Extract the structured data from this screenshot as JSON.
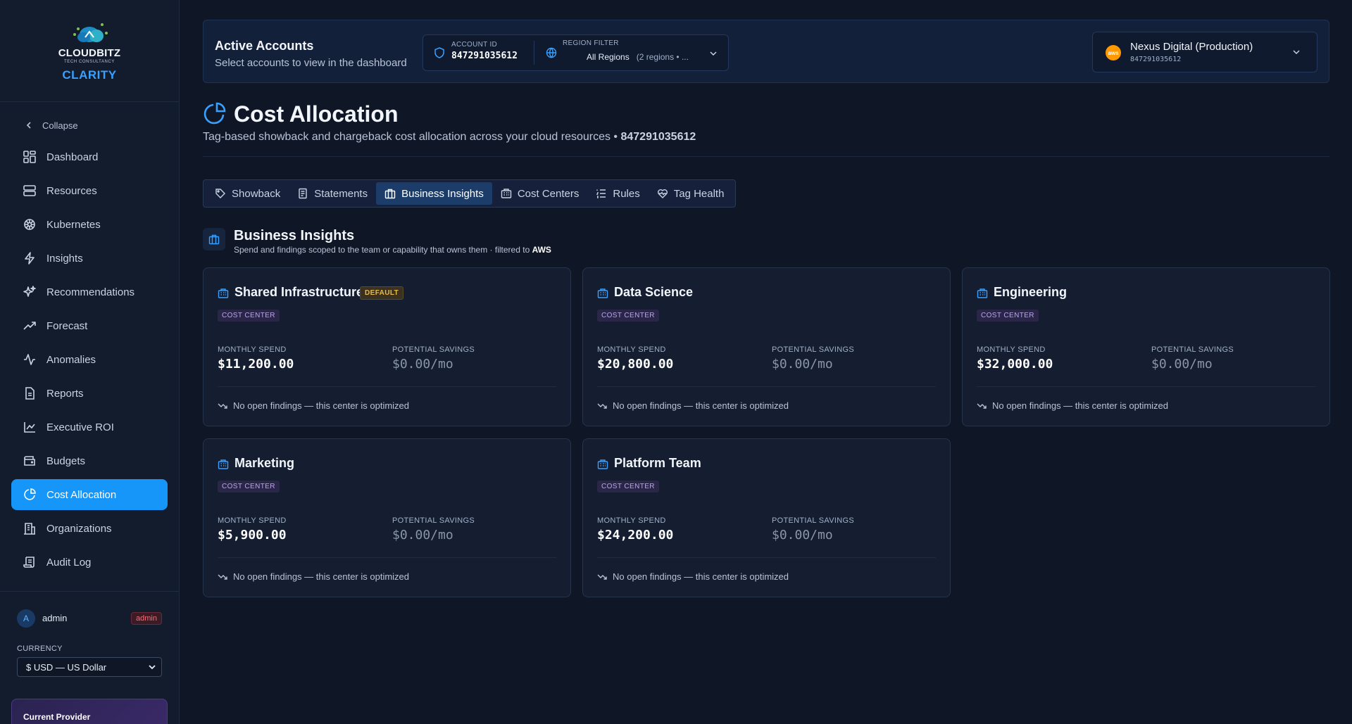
{
  "brand": {
    "name": "CLOUDBITZ",
    "tagline": "TECH CONSULTANCY",
    "app": "CLARITY"
  },
  "sidebar": {
    "collapse_label": "Collapse",
    "items": [
      {
        "label": "Dashboard",
        "icon": "grid-icon"
      },
      {
        "label": "Resources",
        "icon": "server-icon"
      },
      {
        "label": "Kubernetes",
        "icon": "helm-icon"
      },
      {
        "label": "Insights",
        "icon": "bolt-icon"
      },
      {
        "label": "Recommendations",
        "icon": "sparkle-icon"
      },
      {
        "label": "Forecast",
        "icon": "trend-up-icon"
      },
      {
        "label": "Anomalies",
        "icon": "activity-icon"
      },
      {
        "label": "Reports",
        "icon": "document-icon"
      },
      {
        "label": "Executive ROI",
        "icon": "line-chart-icon"
      },
      {
        "label": "Budgets",
        "icon": "wallet-icon"
      },
      {
        "label": "Cost Allocation",
        "icon": "pie-chart-icon",
        "active": true
      },
      {
        "label": "Organizations",
        "icon": "building-icon"
      },
      {
        "label": "Audit Log",
        "icon": "scroll-icon"
      }
    ],
    "user": {
      "initial": "A",
      "name": "admin",
      "role": "admin"
    },
    "currency_label": "CURRENCY",
    "currency_value": "$ USD — US Dollar",
    "provider_label": "Current Provider"
  },
  "topbar": {
    "title": "Active Accounts",
    "subtitle": "Select accounts to view in the dashboard",
    "account_label": "ACCOUNT ID",
    "account_id": "847291035612",
    "region_label": "REGION FILTER",
    "region_value": "All Regions",
    "region_detail": "(2 regions • ...",
    "org_name": "Nexus Digital (Production)",
    "org_id": "847291035612",
    "org_logo": "aws"
  },
  "page": {
    "title": "Cost Allocation",
    "description": "Tag-based showback and chargeback cost allocation across your cloud resources •",
    "account_ref": "847291035612"
  },
  "tabs": [
    {
      "label": "Showback",
      "icon": "tag-icon"
    },
    {
      "label": "Statements",
      "icon": "receipt-icon"
    },
    {
      "label": "Business Insights",
      "icon": "briefcase-icon",
      "active": true
    },
    {
      "label": "Cost Centers",
      "icon": "building-icon"
    },
    {
      "label": "Rules",
      "icon": "list-icon"
    },
    {
      "label": "Tag Health",
      "icon": "heart-pulse-icon"
    }
  ],
  "section": {
    "title": "Business Insights",
    "subtitle": "Spend and findings scoped to the team or capability that owns them · filtered to",
    "filter": "AWS"
  },
  "cards": [
    {
      "name": "Shared Infrastructure",
      "default_badge": "DEFAULT",
      "tag": "COST CENTER",
      "spend_label": "MONTHLY SPEND",
      "spend": "$11,200.00",
      "savings_label": "POTENTIAL SAVINGS",
      "savings": "$0.00/mo",
      "note": "No open findings — this center is optimized"
    },
    {
      "name": "Data Science",
      "default_badge": "",
      "tag": "COST CENTER",
      "spend_label": "MONTHLY SPEND",
      "spend": "$20,800.00",
      "savings_label": "POTENTIAL SAVINGS",
      "savings": "$0.00/mo",
      "note": "No open findings — this center is optimized"
    },
    {
      "name": "Engineering",
      "default_badge": "",
      "tag": "COST CENTER",
      "spend_label": "MONTHLY SPEND",
      "spend": "$32,000.00",
      "savings_label": "POTENTIAL SAVINGS",
      "savings": "$0.00/mo",
      "note": "No open findings — this center is optimized"
    },
    {
      "name": "Marketing",
      "default_badge": "",
      "tag": "COST CENTER",
      "spend_label": "MONTHLY SPEND",
      "spend": "$5,900.00",
      "savings_label": "POTENTIAL SAVINGS",
      "savings": "$0.00/mo",
      "note": "No open findings — this center is optimized"
    },
    {
      "name": "Platform Team",
      "default_badge": "",
      "tag": "COST CENTER",
      "spend_label": "MONTHLY SPEND",
      "spend": "$24,200.00",
      "savings_label": "POTENTIAL SAVINGS",
      "savings": "$0.00/mo",
      "note": "No open findings — this center is optimized"
    }
  ],
  "colors": {
    "accent": "#1596f8",
    "brand_blue": "#3aa0ff",
    "background": "#0f1726",
    "card": "#141e30",
    "default_badge": "#e9b949",
    "tag": "#b9a8e8"
  }
}
